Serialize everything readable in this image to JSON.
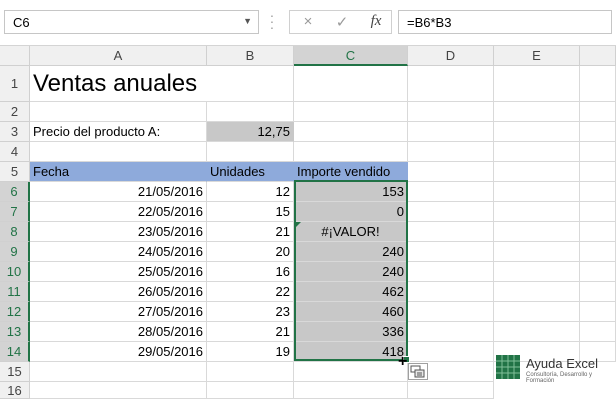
{
  "formula_bar": {
    "name_box": "C6",
    "cancel_icon": "×",
    "enter_icon": "✓",
    "fx_icon": "fx",
    "formula": "=B6*B3"
  },
  "columns": [
    "A",
    "B",
    "C",
    "D",
    "E"
  ],
  "selected_column": "C",
  "rows": [
    "1",
    "2",
    "3",
    "4",
    "5",
    "6",
    "7",
    "8",
    "9",
    "10",
    "11",
    "12",
    "13",
    "14",
    "15",
    "16"
  ],
  "cells": {
    "title": "Ventas anuales",
    "price_label": "Precio del producto A:",
    "price_value": "12,75",
    "header_fecha": "Fecha",
    "header_unidades": "Unidades",
    "header_importe": "Importe vendido"
  },
  "data_rows": [
    {
      "fecha": "21/05/2016",
      "unidades": "12",
      "importe": "153"
    },
    {
      "fecha": "22/05/2016",
      "unidades": "15",
      "importe": "0"
    },
    {
      "fecha": "23/05/2016",
      "unidades": "21",
      "importe": "#¡VALOR!"
    },
    {
      "fecha": "24/05/2016",
      "unidades": "20",
      "importe": "240"
    },
    {
      "fecha": "25/05/2016",
      "unidades": "16",
      "importe": "240"
    },
    {
      "fecha": "26/05/2016",
      "unidades": "22",
      "importe": "462"
    },
    {
      "fecha": "27/05/2016",
      "unidades": "23",
      "importe": "460"
    },
    {
      "fecha": "28/05/2016",
      "unidades": "21",
      "importe": "336"
    },
    {
      "fecha": "29/05/2016",
      "unidades": "19",
      "importe": "418"
    }
  ],
  "logo": {
    "name": "Ayuda Excel",
    "tagline": "Consultoría, Desarrollo y Formación"
  },
  "colors": {
    "accent": "#217346",
    "header_fill": "#8eaadb",
    "gray_fill": "#c8c8c8"
  }
}
